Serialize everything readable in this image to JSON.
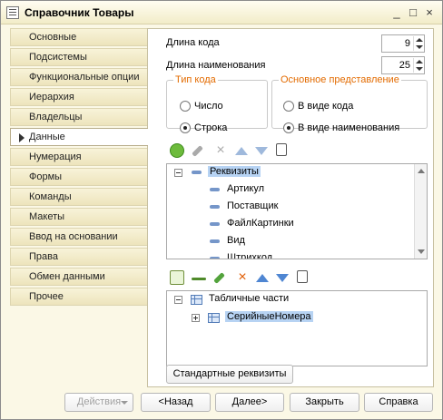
{
  "window": {
    "title": "Справочник Товары",
    "controls": [
      "_",
      "□",
      "×"
    ]
  },
  "tabs": [
    {
      "label": "Основные"
    },
    {
      "label": "Подсистемы"
    },
    {
      "label": "Функциональные опции"
    },
    {
      "label": "Иерархия"
    },
    {
      "label": "Владельцы"
    },
    {
      "label": "Данные",
      "active": true
    },
    {
      "label": "Нумерация"
    },
    {
      "label": "Формы"
    },
    {
      "label": "Команды"
    },
    {
      "label": "Макеты"
    },
    {
      "label": "Ввод на основании"
    },
    {
      "label": "Права"
    },
    {
      "label": "Обмен данными"
    },
    {
      "label": "Прочее"
    }
  ],
  "data_tab": {
    "code_length": {
      "label": "Длина кода",
      "value": "9"
    },
    "name_length": {
      "label": "Длина наименования",
      "value": "25"
    },
    "code_type": {
      "legend": "Тип кода",
      "options": [
        "Число",
        "Строка"
      ],
      "selected": "Строка"
    },
    "main_presentation": {
      "legend": "Основное представление",
      "options": [
        "В виде кода",
        "В виде наименования"
      ],
      "selected": "В виде наименования"
    },
    "attributes_tree": {
      "root": "Реквизиты",
      "items": [
        "Артикул",
        "Поставщик",
        "ФайлКартинки",
        "Вид",
        "Штрихкод"
      ]
    },
    "tabular_tree": {
      "root": "Табличные части",
      "items": [
        "СерийныеНомера"
      ]
    },
    "standard_attrs_button": "Стандартные реквизиты"
  },
  "footer": {
    "actions": "Действия",
    "back": "<Назад",
    "next": "Далее>",
    "close": "Закрыть",
    "help": "Справка"
  },
  "icons": {
    "add": "add-icon",
    "edit": "edit-icon",
    "delete": "delete-icon",
    "up": "move-up-icon",
    "down": "move-down-icon",
    "list": "list-icon"
  },
  "colors": {
    "window_bg": "#fbf8e6",
    "legend": "#e36b00",
    "selection": "#b7d3f3"
  }
}
